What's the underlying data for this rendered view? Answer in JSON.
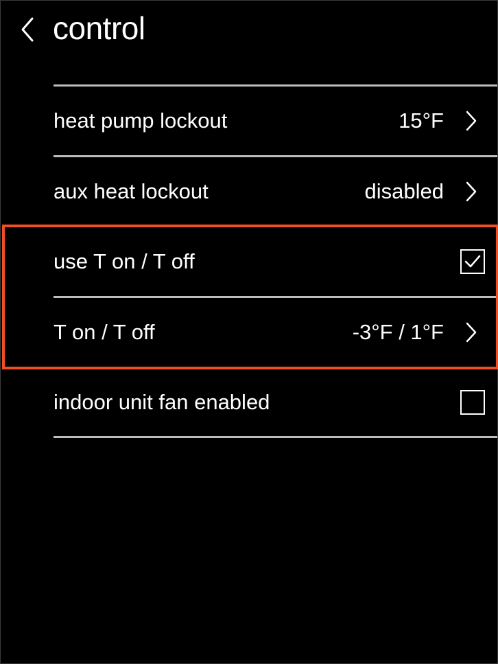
{
  "header": {
    "back_icon": "chevron-left-icon",
    "title": "control"
  },
  "rows": [
    {
      "label": "heat pump lockout",
      "value": "15°F",
      "control": "chevron-right-icon"
    },
    {
      "label": "aux heat lockout",
      "value": "disabled",
      "control": "chevron-right-icon"
    },
    {
      "label": "use T on / T off",
      "control": "checkbox",
      "checked": true
    },
    {
      "label": "T on / T off",
      "value": "-3°F / 1°F",
      "control": "chevron-right-icon"
    },
    {
      "label": "indoor unit fan enabled",
      "control": "checkbox",
      "checked": false
    }
  ],
  "colors": {
    "background": "#000000",
    "text": "#ffffff",
    "divider": "#bdbdbd",
    "highlight": "#f04e23"
  }
}
